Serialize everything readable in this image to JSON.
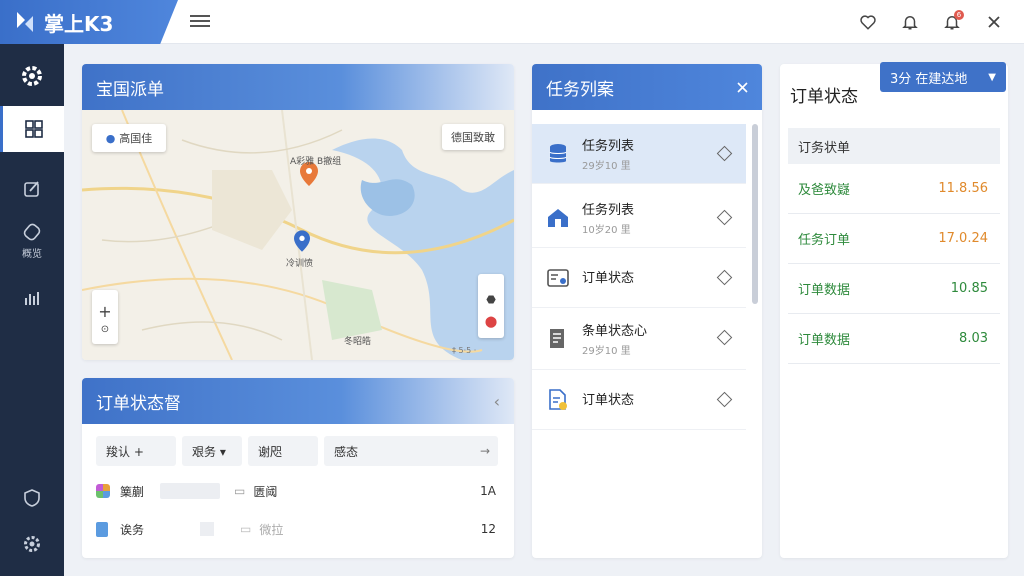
{
  "app": {
    "title": "掌上K3"
  },
  "topbar": {
    "icons": [
      "heart-icon",
      "bell-icon",
      "notification-bell-icon",
      "close-icon"
    ],
    "badge_count": "6"
  },
  "sidebar": {
    "items": [
      {
        "icon": "gear-icon",
        "label": ""
      },
      {
        "icon": "dashboard-icon",
        "label": ""
      },
      {
        "icon": "edit-icon",
        "label": ""
      },
      {
        "icon": "overview-icon",
        "label": "概览"
      },
      {
        "icon": "chart-icon",
        "label": ""
      },
      {
        "icon": "shield-icon",
        "label": ""
      },
      {
        "icon": "settings-icon",
        "label": ""
      }
    ]
  },
  "map_panel": {
    "title": "宝国派单",
    "location_btn": "高国佳",
    "layer_btn": "德国致敢",
    "zoom_in": "+",
    "places": [
      "A彩雅 B撤组",
      "冷训愤",
      "冬昭皓"
    ],
    "copyright": "‡ 5·5 ·"
  },
  "order_panel": {
    "title": "订单状态督",
    "filters": [
      "羧认 +",
      "艰务 ▾",
      "谢咫",
      "感态"
    ],
    "rows": [
      {
        "name": "篥蒯",
        "type": "匮阈",
        "value": "1A"
      },
      {
        "name": "诶务",
        "type": "微拉",
        "value": "12"
      }
    ]
  },
  "task_panel": {
    "title": "任务列案",
    "items": [
      {
        "name": "任务列表",
        "sub": "29岁10 里",
        "icon": "database-icon"
      },
      {
        "name": "任务列表",
        "sub": "10岁20 里",
        "icon": "home-icon"
      },
      {
        "name": "订单状态",
        "sub": "",
        "icon": "dashboard-card-icon"
      },
      {
        "name": "条单状态心",
        "sub": "29岁10 里",
        "icon": "document-icon"
      },
      {
        "name": "订单状态",
        "sub": "",
        "icon": "file-check-icon"
      }
    ]
  },
  "status_panel": {
    "title": "订单状态",
    "dropdown": "3分 在建达地",
    "header": "订务状单",
    "rows": [
      {
        "label": "及爸致嶷",
        "value": "11.8.56",
        "color": "#e08a2c"
      },
      {
        "label": "任务订单",
        "value": "17.0.24",
        "color": "#e08a2c"
      },
      {
        "label": "订单数据",
        "value": "10.85",
        "color": "#2e8a3c"
      },
      {
        "label": "订单数据",
        "value": "8.03",
        "color": "#2e8a3c"
      }
    ]
  },
  "colors": {
    "accent": "#3a6fc9",
    "sidebar": "#1f2d45"
  }
}
